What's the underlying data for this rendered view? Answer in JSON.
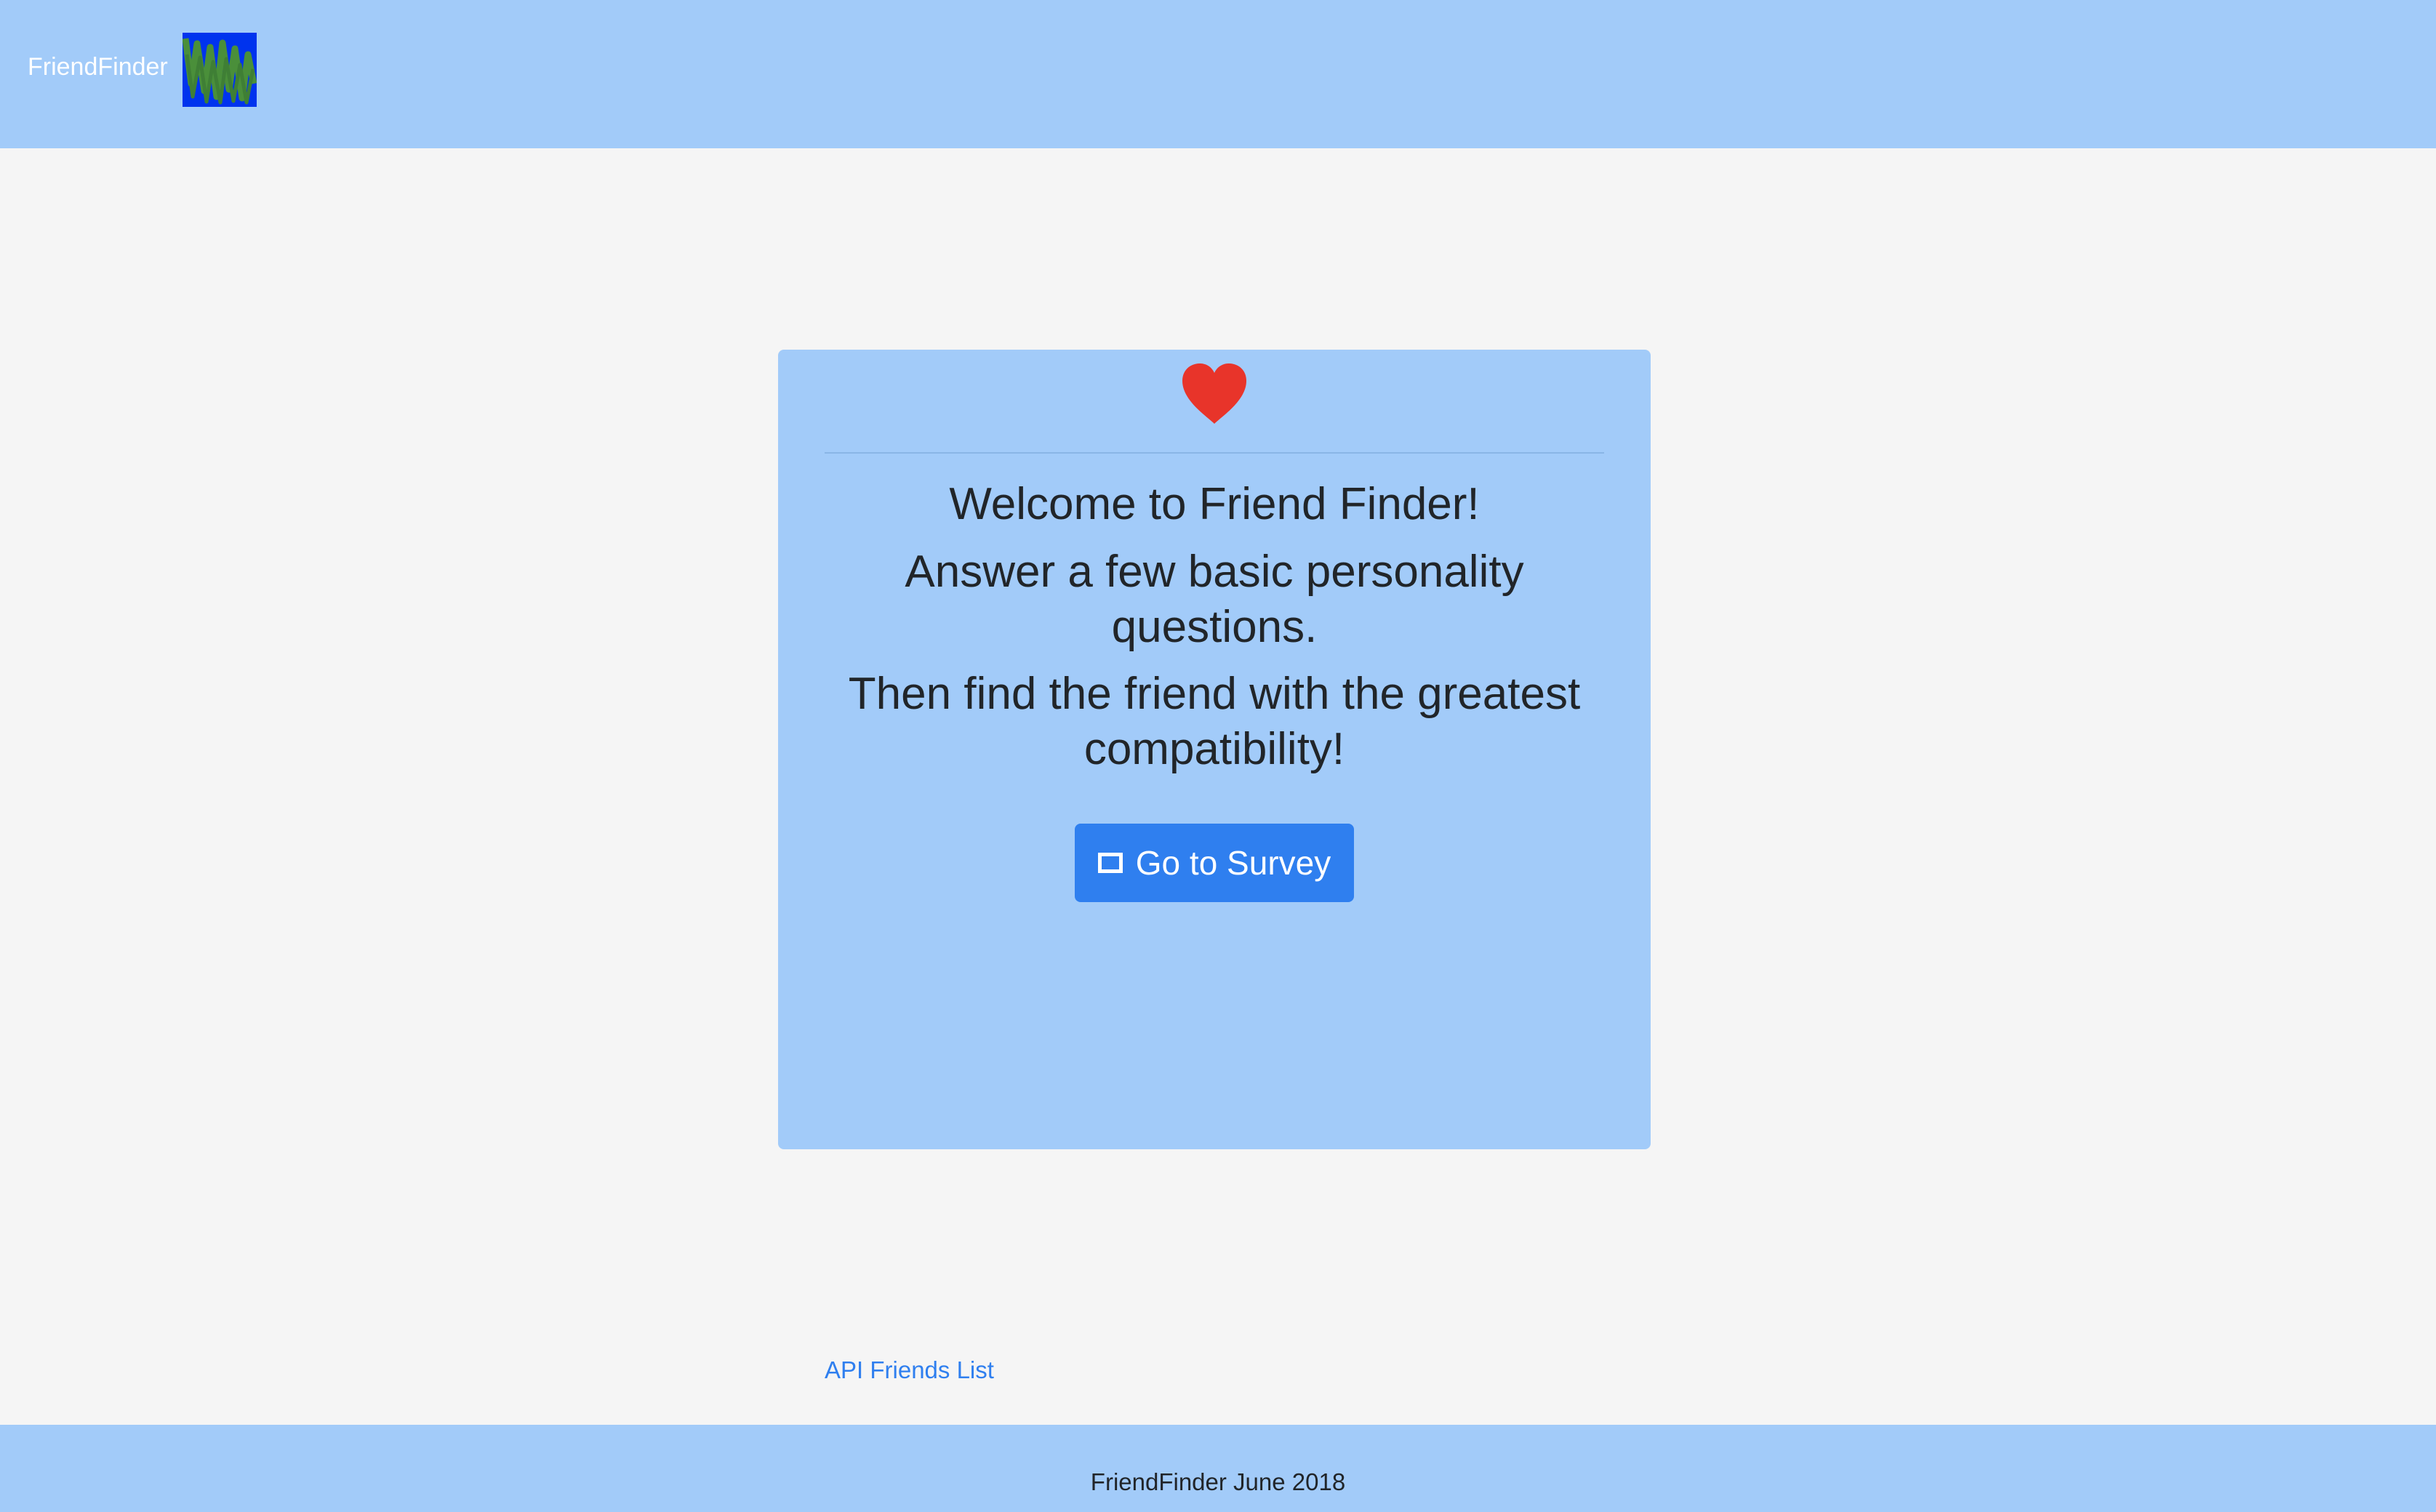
{
  "navbar": {
    "brand": "FriendFinder",
    "logo_icon": "zigzag-logo-icon"
  },
  "card": {
    "icon": "heart-icon",
    "headline_welcome": "Welcome to Friend Finder!",
    "headline_answer": "Answer a few basic personality questions.",
    "headline_then": "Then find the friend with the greatest compatibility!",
    "survey_button": {
      "icon": "checkbox-icon",
      "label": "Go to Survey"
    },
    "api_link": "API Friends List"
  },
  "footer": {
    "text": "FriendFinder June 2018"
  },
  "colors": {
    "navbar_bg": "#a2cbf9",
    "page_bg": "#f5f5f5",
    "card_bg": "#a2cbf9",
    "button_bg": "#2f7fef",
    "link": "#2f7fef",
    "heart": "#e8342a",
    "logo_bg": "#0033ee"
  }
}
